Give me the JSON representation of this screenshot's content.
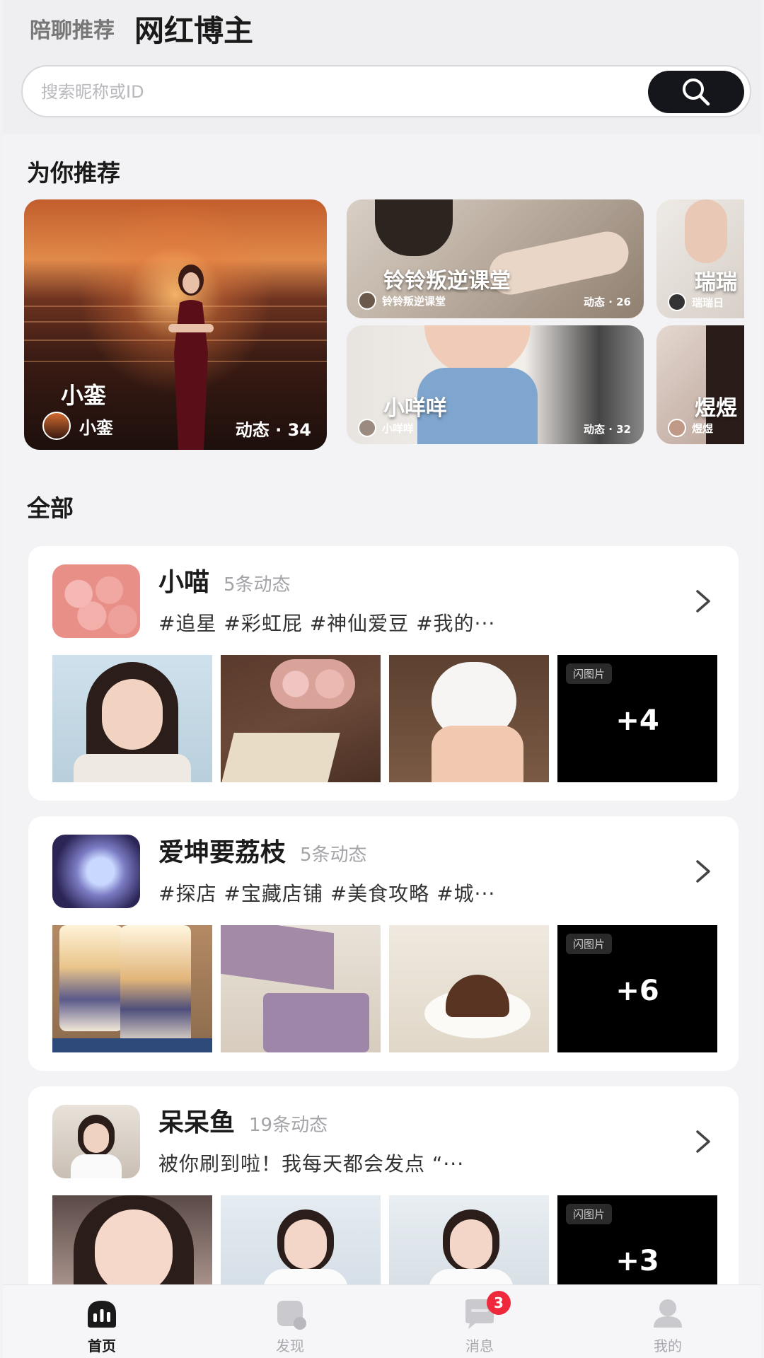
{
  "header": {
    "tabs": [
      {
        "label": "陪聊推荐",
        "active": false
      },
      {
        "label": "网红博主",
        "active": true
      }
    ]
  },
  "search": {
    "placeholder": "搜索昵称或ID",
    "value": "",
    "button_icon": "search-icon"
  },
  "recommend": {
    "title": "为你推荐",
    "featured": {
      "name": "小銮",
      "author": "小銮",
      "count": "动态 · 34"
    },
    "items": [
      {
        "name": "铃铃叛逆课堂",
        "author": "铃铃叛逆课堂",
        "count": "动态 · 26"
      },
      {
        "name": "小咩咩",
        "author": "小咩咩",
        "count": "动态 · 32"
      },
      {
        "name": "瑞瑞",
        "author": "瑞瑞日",
        "count": ""
      },
      {
        "name": "煜煜",
        "author": "煜煜",
        "count": ""
      }
    ]
  },
  "all": {
    "title": "全部",
    "cards": [
      {
        "name": "小喵",
        "count": "5条动态",
        "desc": "#追星 #彩虹屁 #神仙爱豆 #我的···",
        "more_tag": "闪图片",
        "more_count": "+4"
      },
      {
        "name": "爱坤要荔枝",
        "count": "5条动态",
        "desc": "#探店 #宝藏店铺 #美食攻略 #城···",
        "more_tag": "闪图片",
        "more_count": "+6"
      },
      {
        "name": "呆呆鱼",
        "count": "19条动态",
        "desc": "被你刷到啦！我每天都会发点 “···",
        "more_tag": "闪图片",
        "more_count": "+3"
      }
    ]
  },
  "nav": {
    "items": [
      {
        "label": "首页",
        "icon": "home-icon",
        "active": true
      },
      {
        "label": "发现",
        "icon": "discover-icon",
        "active": false
      },
      {
        "label": "消息",
        "icon": "message-icon",
        "active": false,
        "badge": "3"
      },
      {
        "label": "我的",
        "icon": "profile-icon",
        "active": false
      }
    ]
  },
  "colors": {
    "accent": "#15161b",
    "badge": "#f0283c",
    "background": "#f3f3f5"
  }
}
